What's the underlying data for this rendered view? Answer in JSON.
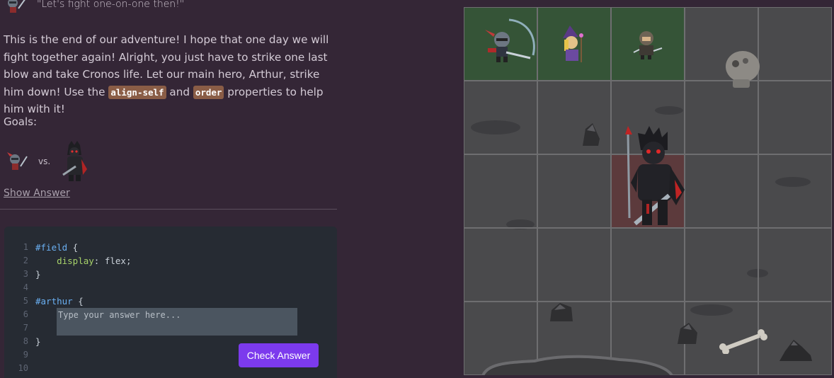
{
  "level": {
    "quote": "\"Let's fight one-on-one then!\"",
    "story_parts": [
      "This is the end of our adventure! I hope that one day we will fight together again! Alright, you just have to strike one last blow and take Cronos life. Let our main hero, Arthur, strike him down! Use the ",
      " and ",
      " properties to help him with it!"
    ],
    "code_terms": [
      "align-self",
      "order"
    ],
    "goals_label": "Goals:",
    "vs_label": "vs.",
    "show_answer": "Show Answer"
  },
  "editor": {
    "line_numbers": [
      "1",
      "2",
      "3",
      "4",
      "5",
      "6",
      "7",
      "8",
      "9",
      "10"
    ],
    "line1_selector": "#field",
    "line1_brace": " {",
    "line2_prop": "display",
    "line2_value": ": flex;",
    "line3": "}",
    "line5_selector": "#arthur",
    "line5_brace": " {",
    "line8": "}",
    "placeholder": "Type your answer here...",
    "answer_value": "",
    "check_label": "Check Answer"
  },
  "board": {
    "rows": 5,
    "cols": 5,
    "green_cells": [
      [
        0,
        0
      ],
      [
        0,
        1
      ],
      [
        0,
        2
      ]
    ],
    "red_cells": [
      [
        2,
        2
      ]
    ],
    "characters": [
      "arthur",
      "wizard",
      "rogue",
      "cronos"
    ]
  },
  "colors": {
    "background": "#342636",
    "accent": "#7c3aed",
    "chip": "#8a5d46",
    "goal_green": "#355437",
    "goal_red": "#5c3a3c"
  }
}
